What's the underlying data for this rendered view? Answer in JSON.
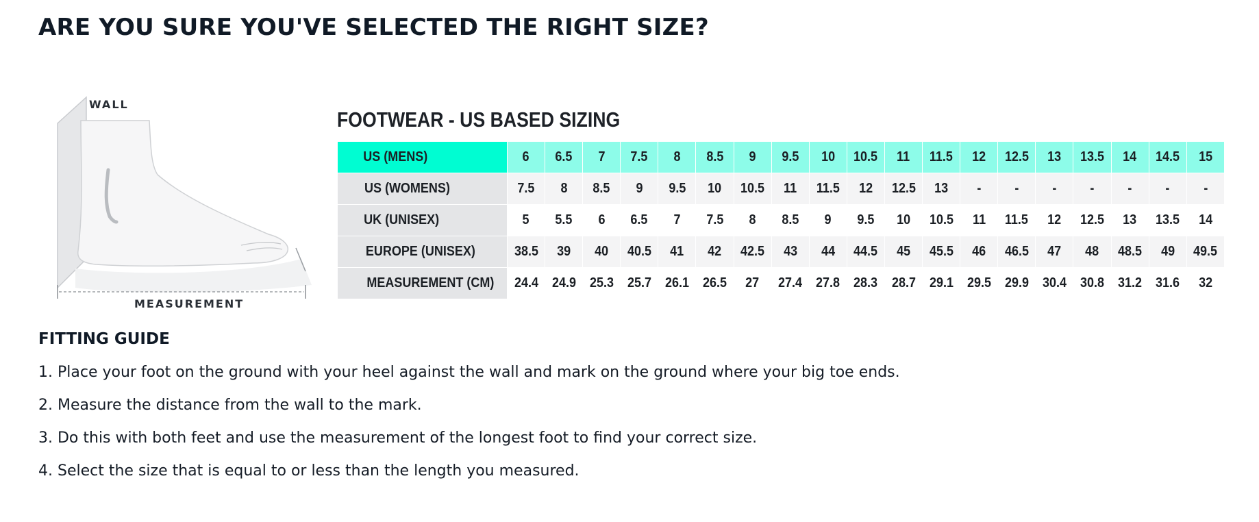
{
  "header": {
    "title": "ARE YOU SURE YOU'VE SELECTED THE RIGHT SIZE?"
  },
  "figure": {
    "wall_label": "WALL",
    "measurement_label": "MEASUREMENT",
    "icon": "foot-measurement-icon"
  },
  "size_chart": {
    "title": "FOOTWEAR - US BASED SIZING",
    "colors": {
      "header_accent": "#00fdd2",
      "header_light": "#8dfce9",
      "label_gray": "#e4e5e7",
      "row_alt": "#f4f4f5"
    },
    "rows": [
      {
        "label": "US (MENS)",
        "cells": [
          "6",
          "6.5",
          "7",
          "7.5",
          "8",
          "8.5",
          "9",
          "9.5",
          "10",
          "10.5",
          "11",
          "11.5",
          "12",
          "12.5",
          "13",
          "13.5",
          "14",
          "14.5",
          "15"
        ]
      },
      {
        "label": "US (WOMENS)",
        "cells": [
          "7.5",
          "8",
          "8.5",
          "9",
          "9.5",
          "10",
          "10.5",
          "11",
          "11.5",
          "12",
          "12.5",
          "13",
          "-",
          "-",
          "-",
          "-",
          "-",
          "-",
          "-"
        ]
      },
      {
        "label": "UK (UNISEX)",
        "cells": [
          "5",
          "5.5",
          "6",
          "6.5",
          "7",
          "7.5",
          "8",
          "8.5",
          "9",
          "9.5",
          "10",
          "10.5",
          "11",
          "11.5",
          "12",
          "12.5",
          "13",
          "13.5",
          "14"
        ]
      },
      {
        "label": "EUROPE (UNISEX)",
        "cells": [
          "38.5",
          "39",
          "40",
          "40.5",
          "41",
          "42",
          "42.5",
          "43",
          "44",
          "44.5",
          "45",
          "45.5",
          "46",
          "46.5",
          "47",
          "48",
          "48.5",
          "49",
          "49.5"
        ]
      },
      {
        "label": "MEASUREMENT (CM)",
        "cells": [
          "24.4",
          "24.9",
          "25.3",
          "25.7",
          "26.1",
          "26.5",
          "27",
          "27.4",
          "27.8",
          "28.3",
          "28.7",
          "29.1",
          "29.5",
          "29.9",
          "30.4",
          "30.8",
          "31.2",
          "31.6",
          "32"
        ]
      }
    ]
  },
  "fitting_guide": {
    "title": "FITTING GUIDE",
    "steps": [
      "1. Place your foot on the ground with your heel against the wall and mark on the ground where your big toe ends.",
      "2. Measure the distance from the wall to the mark.",
      "3. Do this with both feet and use the measurement of the longest foot to find your correct size.",
      "4. Select the size that is equal to or less than the length you measured."
    ]
  }
}
